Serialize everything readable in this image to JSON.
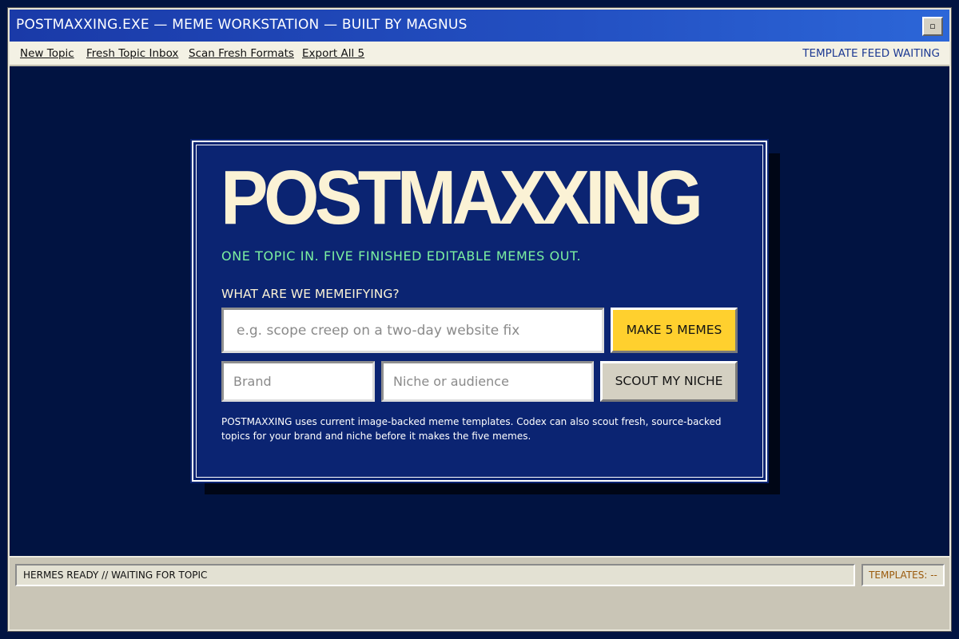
{
  "window": {
    "title": "POSTMAXXING.EXE — MEME WORKSTATION — BUILT BY MAGNUS",
    "control_glyph": "▫"
  },
  "menu": {
    "items": [
      {
        "label": "New Topic"
      },
      {
        "label": "Fresh Topic Inbox"
      },
      {
        "label": "Scan Fresh Formats"
      },
      {
        "label": "Export All 5"
      }
    ],
    "feed_status": "TEMPLATE FEED WAITING"
  },
  "card": {
    "brand": "POSTMAXXING",
    "tagline": "ONE TOPIC IN. FIVE FINISHED EDITABLE MEMES OUT.",
    "prompt_label": "WHAT ARE WE MEMEIFYING?",
    "topic_input": {
      "value": "",
      "placeholder": "e.g. scope creep on a two-day website fix"
    },
    "make_button": "MAKE 5 MEMES",
    "brand_input": {
      "value": "",
      "placeholder": "Brand"
    },
    "niche_input": {
      "value": "",
      "placeholder": "Niche or audience"
    },
    "scout_button": "SCOUT MY NICHE",
    "info": "POSTMAXXING uses current image-backed meme templates. Codex can also scout fresh, source-backed topics for your brand and niche before it makes the five memes."
  },
  "status": {
    "message": "HERMES READY // WAITING FOR TOPIC",
    "templates": "TEMPLATES: --"
  },
  "colors": {
    "background": "#011341",
    "card": "#0b2472",
    "accent_yellow": "#ffd02e",
    "tagline_green": "#7cf0a0",
    "brand_cream": "#fbf2d5",
    "titlebar_blue": "#2350c2"
  }
}
